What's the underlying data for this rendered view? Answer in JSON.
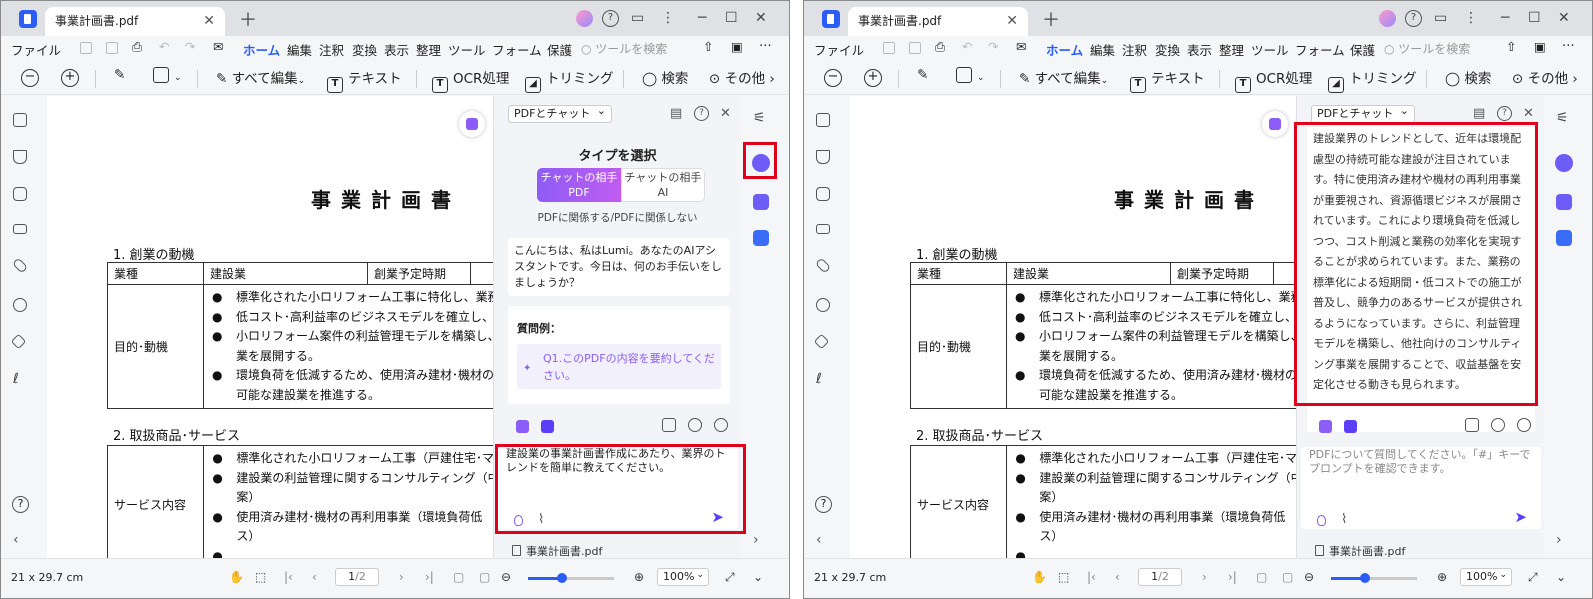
{
  "app": {
    "tab_title": "事業計画書.pdf",
    "menu": [
      "ファイル",
      "ホーム",
      "編集",
      "注釈",
      "変換",
      "表示",
      "整理",
      "ツール",
      "フォーム",
      "保護"
    ],
    "search_placeholder": "ツールを検索",
    "toolbar": {
      "edit_all": "すべて編集",
      "text": "テキスト",
      "ocr": "OCR処理",
      "crop": "トリミング",
      "search": "検索",
      "more": "その他"
    }
  },
  "document": {
    "title": "事業計画書",
    "section1": "1. 創業の動機",
    "table1": {
      "header": [
        "業種",
        "建設業",
        "創業予定時期"
      ],
      "row_label": "目的･動機",
      "bullets": [
        "標準化された小ロリフォーム工事に特化し、業務",
        "低コスト･高利益率のビジネスモデルを確立し、競",
        "小ロリフォーム案件の利益管理モデルを構築し、",
        "環境負荷を低減するため、使用済み建材･機材の"
      ],
      "continuations": [
        "業を展開する。",
        "可能な建設業を推進する。"
      ]
    },
    "section2": "2. 取扱商品･サービス",
    "table2": {
      "row_label": "サービス内容",
      "bullets": [
        "標準化された小ロリフォーム工事（戸建住宅･マン",
        "建設業の利益管理に関するコンサルティング（中",
        "使用済み建材･機材の再利用事業（環境負荷低"
      ],
      "continuations": [
        "案）",
        "ス）"
      ]
    }
  },
  "panel": {
    "mode_select": "PDFとチャット",
    "type_title": "タイプを選択",
    "seg_pdf": [
      "チャットの相手",
      "PDF"
    ],
    "seg_ai": [
      "チャットの相手",
      "AI"
    ],
    "seg_caption": "PDFに関係する/PDFに関係しない",
    "greeting": "こんにちは、私はLumi。あなたのAIアシスタントです。今日は、何のお手伝いをしましょうか？",
    "question_label": "質問例：",
    "question1": "Q1.このPDFの内容を要約してください。",
    "input_text": "建設業の事業計画書作成にあたり、業界のトレンドを簡単に教えてください。",
    "input_placeholder": "PDFについて質問してください。「#」キーでプロンプトを確認できます。",
    "response": "建設業界のトレンドとして、近年は環境配慮型の持続可能な建設が注目されています。特に使用済み建材や機材の再利用事業が重要視され、資源循環ビジネスが展開されています。これにより環境負荷を低減しつつ、コスト削減と業務の効率化を実現することが求められています。また、業務の標準化による短期間・低コストでの施工が普及し、競争力のあるサービスが提供されるようになっています。さらに、利益管理モデルを構築し、他社向けのコンサルティング事業を展開することで、収益基盤を安定化させる動きも見られます。",
    "file_name": "事業計画書.pdf"
  },
  "status": {
    "dimensions": "21 x 29.7 cm",
    "page_current": "1",
    "page_total": "/2",
    "zoom": "100%",
    "zoom_level": 0.4
  },
  "colors": {
    "accent": "#2b5cf6",
    "purple": "#8b5cf6",
    "highlight": "#e0001b"
  }
}
